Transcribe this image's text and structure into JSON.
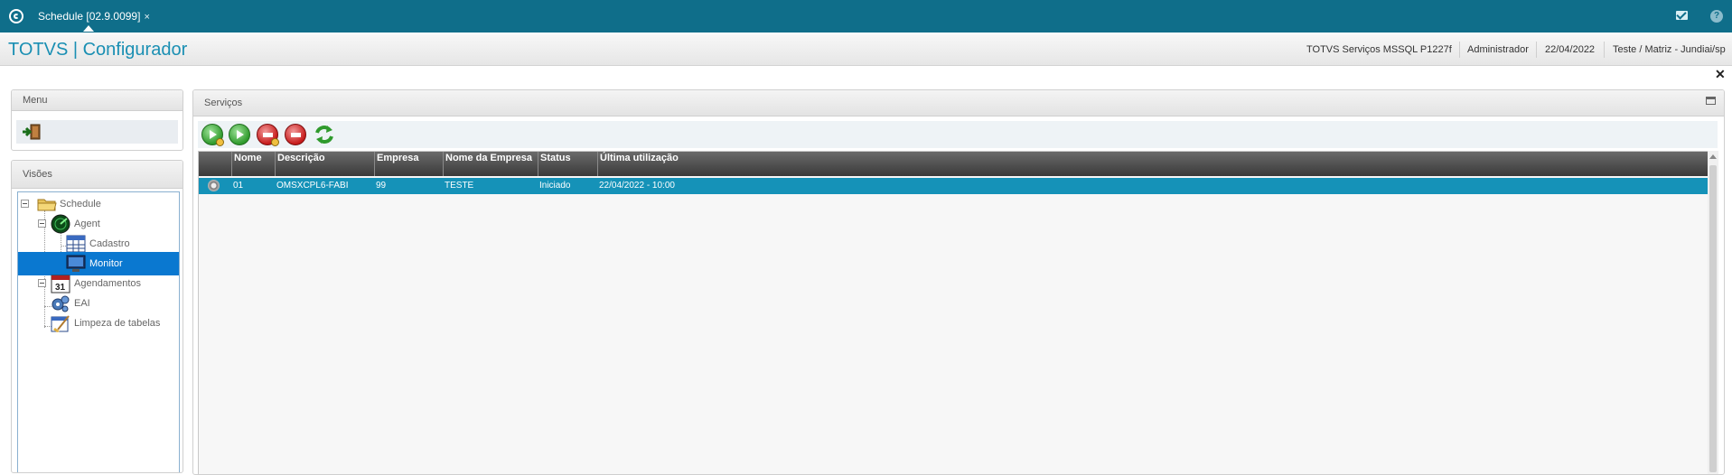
{
  "topbar": {
    "tab_label": "Schedule [02.9.0099]",
    "tab_close": "×",
    "help_label": "?"
  },
  "header": {
    "app_title": "TOTVS | Configurador",
    "environment": "TOTVS Serviços MSSQL P1227f",
    "user": "Administrador",
    "date": "22/04/2022",
    "branch": "Teste / Matriz - Jundiai/sp",
    "close_label": "✕"
  },
  "menu": {
    "title": "Menu",
    "exit_icon": "exit-door-icon"
  },
  "visoes": {
    "title": "Visões",
    "tree": [
      {
        "label": "Schedule",
        "icon": "folder-icon"
      },
      {
        "label": "Agent",
        "icon": "radar-icon"
      },
      {
        "label": "Cadastro",
        "icon": "table-icon"
      },
      {
        "label": "Monitor",
        "icon": "monitor-icon",
        "selected": true
      },
      {
        "label": "Agendamentos",
        "icon": "calendar-icon"
      },
      {
        "label": "EAI",
        "icon": "gears-icon"
      },
      {
        "label": "Limpeza de tabelas",
        "icon": "clean-table-icon"
      }
    ],
    "calendar_number": "31"
  },
  "servicos": {
    "title": "Serviços",
    "toolbar": [
      "start-all-icon",
      "start-icon",
      "stop-all-icon",
      "stop-icon",
      "refresh-icon"
    ],
    "columns": [
      "Nome",
      "Descrição",
      "Empresa",
      "Nome da Empresa",
      "Status",
      "Última utilização"
    ],
    "rows": [
      {
        "nome": "01",
        "descricao": "OMSXCPL6-FABI",
        "empresa": "99",
        "nome_empresa": "TESTE",
        "status": "Iniciado",
        "ultima": "22/04/2022 - 10:00"
      }
    ]
  },
  "colors": {
    "topbar": "#0f6e8a",
    "title": "#1a8fb3",
    "selection": "#0a78d0",
    "row_highlight": "#1592b8"
  }
}
